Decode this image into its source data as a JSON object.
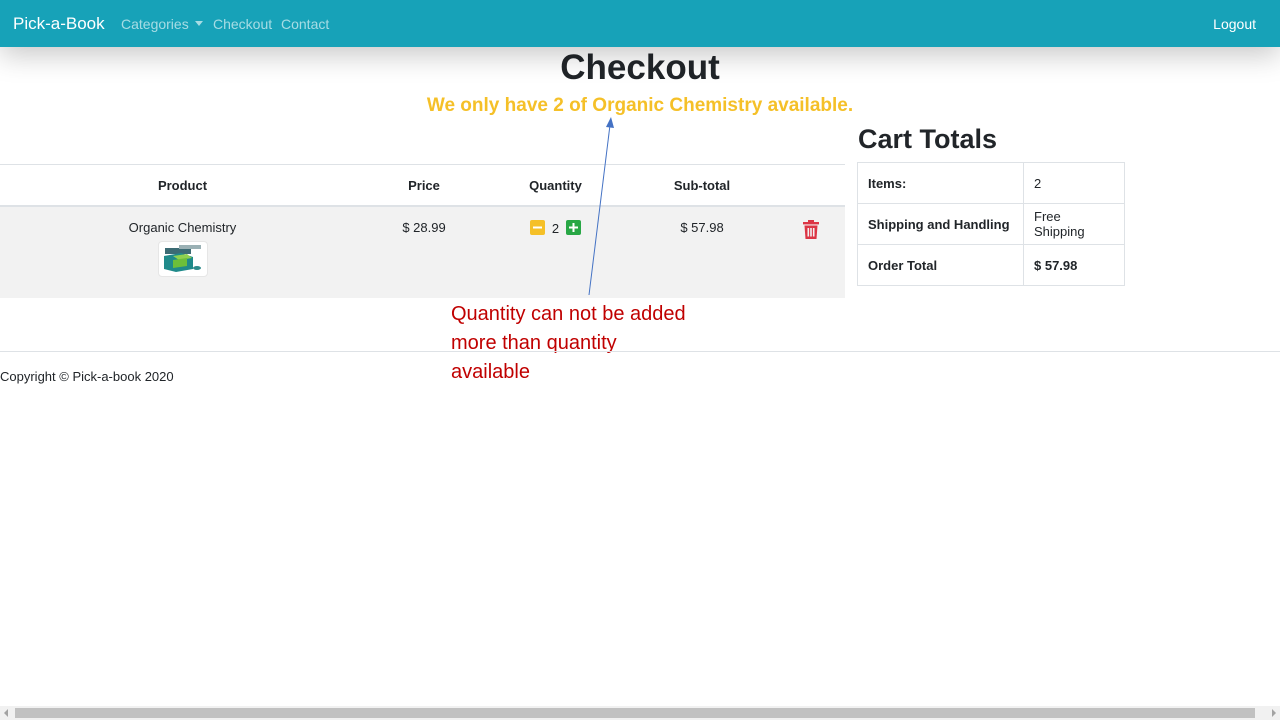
{
  "nav": {
    "brand": "Pick-a-Book",
    "categories": "Categories",
    "checkout": "Checkout",
    "contact": "Contact",
    "logout": "Logout",
    "bar_color": "#17a2b8"
  },
  "page": {
    "title": "Checkout",
    "warning": "We only have 2 of Organic Chemistry available.",
    "warning_color": "#f5c028"
  },
  "cart": {
    "headers": {
      "product": "Product",
      "price": "Price",
      "quantity": "Quantity",
      "subtotal": "Sub-total"
    },
    "items": [
      {
        "name": "Organic Chemistry",
        "price": "$ 28.99",
        "quantity": "2",
        "subtotal": "$ 57.98",
        "image_icon": "book-cover-icon",
        "delete_icon": "trash-icon"
      }
    ]
  },
  "totals": {
    "title": "Cart Totals",
    "rows": [
      {
        "label": "Items:",
        "value": "2"
      },
      {
        "label": "Shipping and Handling",
        "value": "Free Shipping"
      },
      {
        "label": "Order Total",
        "value": "$ 57.98"
      }
    ]
  },
  "annotation": {
    "line1": "Quantity can not be added",
    "line2": "more than quantity",
    "line3": "available",
    "color": "#c00000"
  },
  "footer": {
    "copyright": "Copyright © Pick-a-book 2020"
  }
}
